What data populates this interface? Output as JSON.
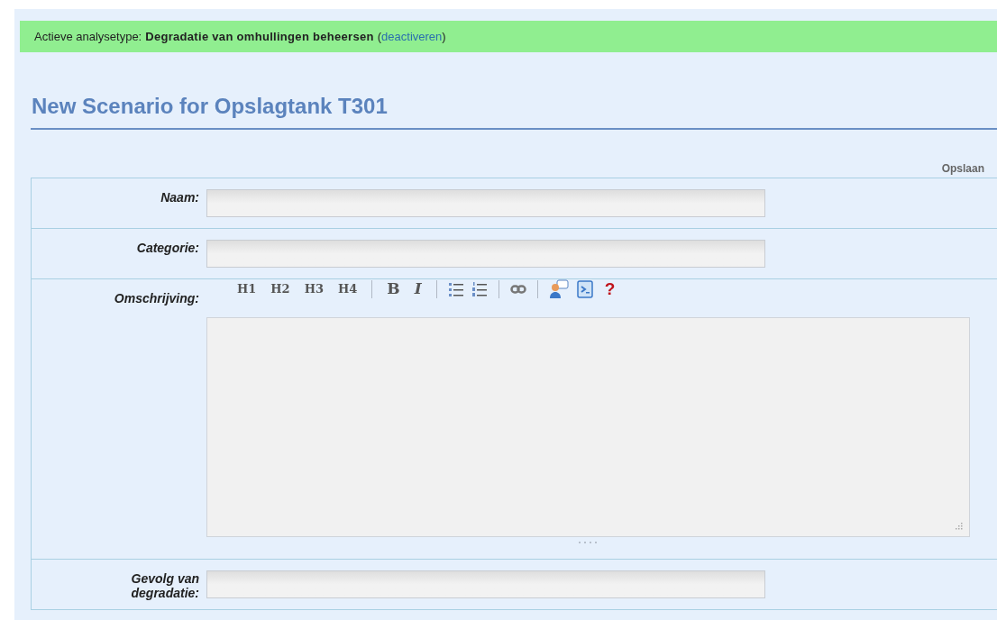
{
  "banner": {
    "label": "Actieve analysetype:",
    "value": "Degradatie van omhullingen beheersen",
    "open": "(",
    "link": "deactiveren",
    "close": ")"
  },
  "title": "New Scenario for Opslagtank T301",
  "save_label": "Opslaan",
  "fields": [
    {
      "label": "Naam:",
      "kind": "input"
    },
    {
      "label": "Categorie:",
      "kind": "input"
    },
    {
      "label": "Omschrijving:",
      "kind": "editor",
      "toolbar": [
        [
          {
            "kind": "heading",
            "label": "H1"
          },
          {
            "kind": "heading",
            "label": "H2"
          },
          {
            "kind": "heading",
            "label": "H3"
          },
          {
            "kind": "heading",
            "label": "H4"
          }
        ],
        [
          {
            "kind": "bold",
            "label": "B"
          },
          {
            "kind": "italic",
            "label": "I"
          }
        ],
        [
          {
            "kind": "bullet-list"
          },
          {
            "kind": "numbered-list"
          }
        ],
        [
          {
            "kind": "link"
          }
        ],
        [
          {
            "kind": "user"
          },
          {
            "kind": "document"
          },
          {
            "kind": "help",
            "label": "?"
          }
        ]
      ]
    },
    {
      "label": "Gevolg van degradatie:",
      "kind": "input"
    }
  ]
}
